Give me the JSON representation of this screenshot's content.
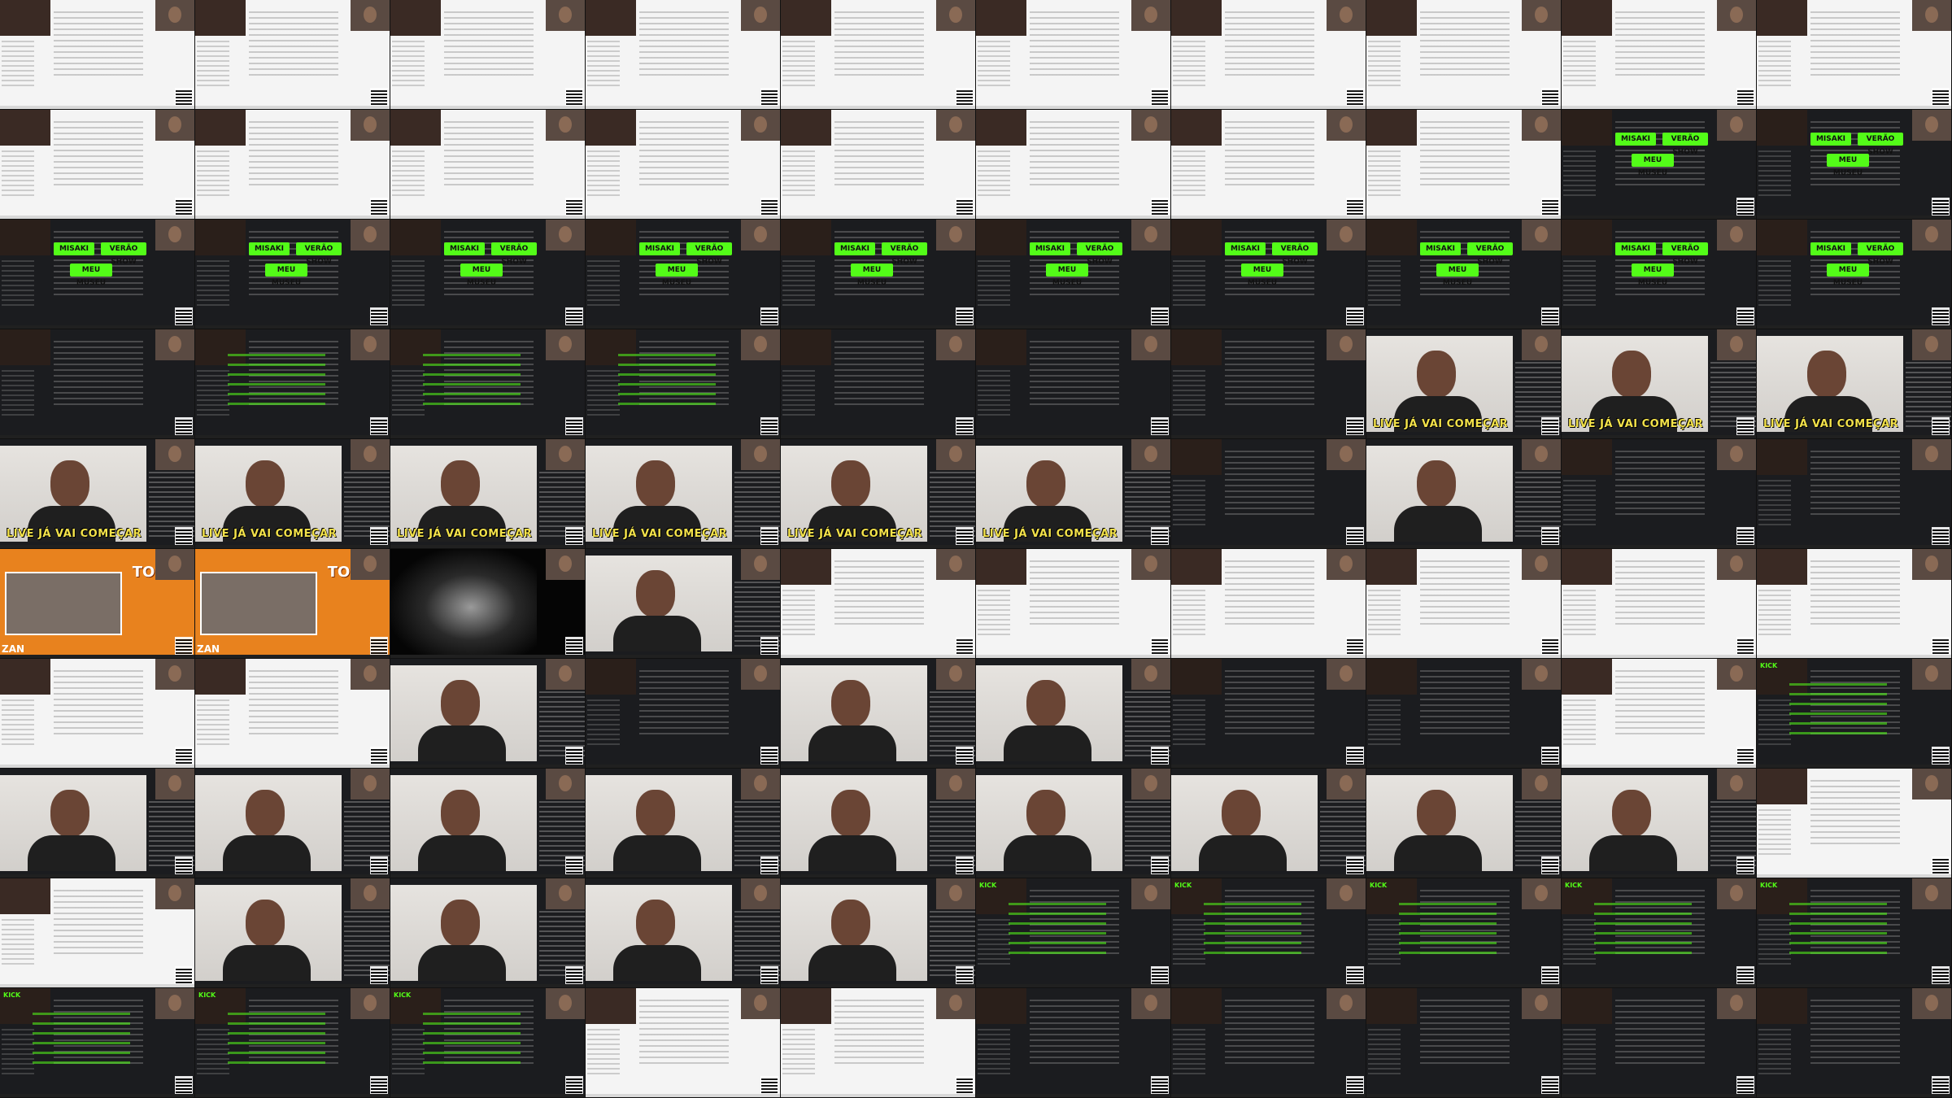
{
  "grid": {
    "cells": [
      {
        "theme": "light",
        "kind": "explorer"
      },
      {
        "theme": "light",
        "kind": "explorer"
      },
      {
        "theme": "light",
        "kind": "explorer"
      },
      {
        "theme": "light",
        "kind": "explorer"
      },
      {
        "theme": "light",
        "kind": "explorer"
      },
      {
        "theme": "light",
        "kind": "explorer"
      },
      {
        "theme": "light",
        "kind": "explorer"
      },
      {
        "theme": "light",
        "kind": "explorer"
      },
      {
        "theme": "light",
        "kind": "explorer"
      },
      {
        "theme": "light",
        "kind": "explorer"
      },
      {
        "theme": "light",
        "kind": "explorer"
      },
      {
        "theme": "light",
        "kind": "explorer"
      },
      {
        "theme": "light",
        "kind": "explorer"
      },
      {
        "theme": "light",
        "kind": "explorer"
      },
      {
        "theme": "light",
        "kind": "explorer"
      },
      {
        "theme": "light",
        "kind": "explorer"
      },
      {
        "theme": "light",
        "kind": "explorer"
      },
      {
        "theme": "light",
        "kind": "explorer"
      },
      {
        "theme": "dark",
        "kind": "buttons"
      },
      {
        "theme": "dark",
        "kind": "buttons"
      },
      {
        "theme": "dark",
        "kind": "buttons"
      },
      {
        "theme": "dark",
        "kind": "buttons"
      },
      {
        "theme": "dark",
        "kind": "buttons"
      },
      {
        "theme": "dark",
        "kind": "buttons"
      },
      {
        "theme": "dark",
        "kind": "buttons"
      },
      {
        "theme": "dark",
        "kind": "buttons"
      },
      {
        "theme": "dark",
        "kind": "buttons"
      },
      {
        "theme": "dark",
        "kind": "buttons"
      },
      {
        "theme": "dark",
        "kind": "buttons"
      },
      {
        "theme": "dark",
        "kind": "buttons"
      },
      {
        "theme": "dark",
        "kind": "panel"
      },
      {
        "theme": "dark",
        "kind": "greenlist"
      },
      {
        "theme": "dark",
        "kind": "greenlist"
      },
      {
        "theme": "dark",
        "kind": "greenlist"
      },
      {
        "theme": "dark",
        "kind": "panel"
      },
      {
        "theme": "dark",
        "kind": "panel"
      },
      {
        "theme": "dark",
        "kind": "panel"
      },
      {
        "theme": "dark",
        "kind": "livecam"
      },
      {
        "theme": "dark",
        "kind": "livecam"
      },
      {
        "theme": "dark",
        "kind": "livecam"
      },
      {
        "theme": "dark",
        "kind": "livecam"
      },
      {
        "theme": "dark",
        "kind": "livecam"
      },
      {
        "theme": "dark",
        "kind": "livecam"
      },
      {
        "theme": "dark",
        "kind": "livecam"
      },
      {
        "theme": "dark",
        "kind": "livecam"
      },
      {
        "theme": "dark",
        "kind": "livecam"
      },
      {
        "theme": "dark",
        "kind": "panel"
      },
      {
        "theme": "dark",
        "kind": "webcam"
      },
      {
        "theme": "dark",
        "kind": "panel"
      },
      {
        "theme": "dark",
        "kind": "panel"
      },
      {
        "theme": "orange",
        "kind": "promo"
      },
      {
        "theme": "orange",
        "kind": "promo"
      },
      {
        "theme": "black",
        "kind": "concert"
      },
      {
        "theme": "dark",
        "kind": "webcam"
      },
      {
        "theme": "light",
        "kind": "explorer"
      },
      {
        "theme": "light",
        "kind": "explorer"
      },
      {
        "theme": "light",
        "kind": "explorer"
      },
      {
        "theme": "light",
        "kind": "explorer"
      },
      {
        "theme": "light",
        "kind": "explorer"
      },
      {
        "theme": "light",
        "kind": "explorer"
      },
      {
        "theme": "light",
        "kind": "explorer"
      },
      {
        "theme": "light",
        "kind": "explorer"
      },
      {
        "theme": "dark",
        "kind": "webcam"
      },
      {
        "theme": "dark",
        "kind": "panel"
      },
      {
        "theme": "dark",
        "kind": "webcam"
      },
      {
        "theme": "dark",
        "kind": "webcam"
      },
      {
        "theme": "dark",
        "kind": "panel"
      },
      {
        "theme": "dark",
        "kind": "panel"
      },
      {
        "theme": "light",
        "kind": "explorer"
      },
      {
        "theme": "dark",
        "kind": "kick"
      },
      {
        "theme": "dark",
        "kind": "webcam"
      },
      {
        "theme": "dark",
        "kind": "webcam"
      },
      {
        "theme": "dark",
        "kind": "webcam"
      },
      {
        "theme": "dark",
        "kind": "webcam"
      },
      {
        "theme": "dark",
        "kind": "webcam"
      },
      {
        "theme": "dark",
        "kind": "webcam"
      },
      {
        "theme": "dark",
        "kind": "webcam"
      },
      {
        "theme": "dark",
        "kind": "webcam"
      },
      {
        "theme": "dark",
        "kind": "webcam"
      },
      {
        "theme": "light",
        "kind": "explorer"
      },
      {
        "theme": "light",
        "kind": "explorer"
      },
      {
        "theme": "dark",
        "kind": "webcam"
      },
      {
        "theme": "dark",
        "kind": "webcam"
      },
      {
        "theme": "dark",
        "kind": "webcam"
      },
      {
        "theme": "dark",
        "kind": "webcam"
      },
      {
        "theme": "dark",
        "kind": "kick"
      },
      {
        "theme": "dark",
        "kind": "kick"
      },
      {
        "theme": "dark",
        "kind": "kick"
      },
      {
        "theme": "dark",
        "kind": "kick"
      },
      {
        "theme": "dark",
        "kind": "kick"
      },
      {
        "theme": "dark",
        "kind": "kick"
      },
      {
        "theme": "dark",
        "kind": "kick"
      },
      {
        "theme": "dark",
        "kind": "kick"
      },
      {
        "theme": "light",
        "kind": "explorer"
      },
      {
        "theme": "light",
        "kind": "explorer"
      },
      {
        "theme": "dark",
        "kind": "panel"
      },
      {
        "theme": "dark",
        "kind": "panel"
      },
      {
        "theme": "dark",
        "kind": "panel"
      },
      {
        "theme": "dark",
        "kind": "panel"
      },
      {
        "theme": "dark",
        "kind": "panel"
      }
    ]
  },
  "labels": {
    "live_overlay": "LIVE JÁ VAI COMEÇAR",
    "promo_title": "TOBAN",
    "promo_bottom": "ZAN",
    "btn_a": "MISAKI",
    "btn_b": "VERÃO SHOW",
    "btn_c": "MEU MUSEU",
    "kick_logo": "KICK"
  },
  "colors": {
    "kick_green": "#53fc18",
    "overlay_yellow": "#f3e24a",
    "promo_orange": "#e8821e"
  }
}
